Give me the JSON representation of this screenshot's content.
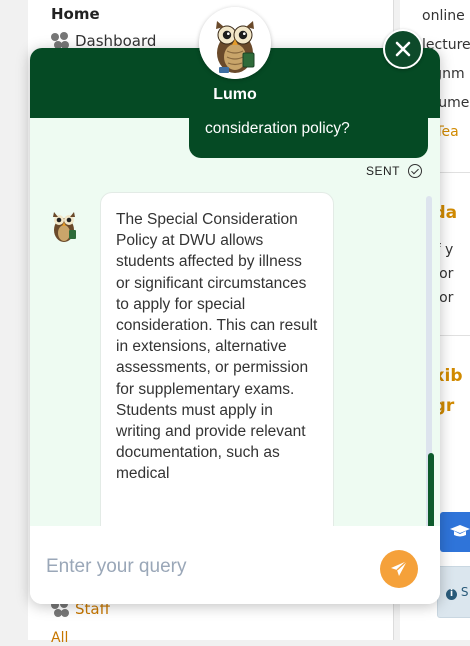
{
  "background": {
    "sidebar": {
      "home_label": "Home",
      "dashboard_label": "Dashboard",
      "staff_label": "Staff",
      "all_label": "All"
    },
    "right_panel": {
      "line1": "online r",
      "line2": "lecturer",
      "line3": "signm",
      "line4": "ocume",
      "line5": "d Tea",
      "heading1": "ada",
      "bullet1": "If y",
      "bullet2": "For",
      "bullet3": "For",
      "heading2a": "exib",
      "heading2b": "ogr",
      "info_text": "S",
      "grad_icon": "graduation-cap-icon",
      "info_icon": "info-icon"
    }
  },
  "chat": {
    "title": "Lumo",
    "user_message": "consideration policy?",
    "sent_status": "SENT",
    "bot_message": "The Special Consideration Policy at DWU allows students affected by illness or significant circumstances to apply for special consideration. This can result in extensions, alternative assessments, or permission for supplementary exams. Students must apply in writing and provide relevant documentation, such as medical",
    "input_placeholder": "Enter your query",
    "colors": {
      "header": "#054a24",
      "body": "#eefbf2",
      "send_button": "#f5a13a",
      "accent_orange": "#d18a00"
    },
    "icons": {
      "avatar": "owl-avatar-icon",
      "close": "close-icon",
      "send": "send-icon",
      "sent": "check-circle-icon"
    }
  }
}
